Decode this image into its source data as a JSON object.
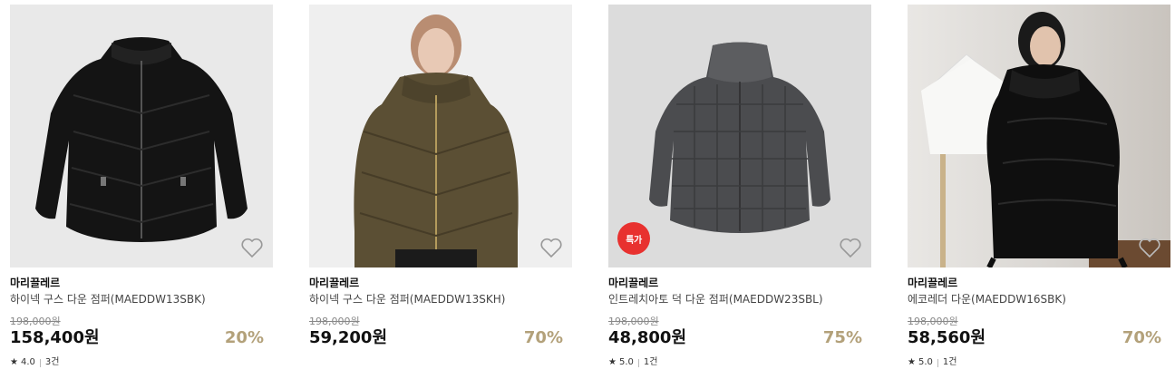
{
  "products": [
    {
      "brand": "마리끌레르",
      "name": "하이넥 구스 다운 점퍼(MAEDDW13SBK)",
      "original_price": "198,000원",
      "price": "158,400원",
      "discount": "20%",
      "rating": "4.0",
      "reviews": "3건",
      "image": "black-puffer-jacket"
    },
    {
      "brand": "마리끌레르",
      "name": "하이넥 구스 다운 점퍼(MAEDDW13SKH)",
      "original_price": "198,000원",
      "price": "59,200원",
      "discount": "70%",
      "image": "khaki-puffer-jacket-model"
    },
    {
      "brand": "마리끌레르",
      "name": "인트레치아토 덕 다운 점퍼(MAEDDW23SBL)",
      "original_price": "198,000원",
      "price": "48,800원",
      "discount": "75%",
      "rating": "5.0",
      "reviews": "1건",
      "badge": "특가",
      "image": "grey-quilted-puffer-jacket"
    },
    {
      "brand": "마리끌레르",
      "name": "에코레더 다운(MAEDDW16SBK)",
      "original_price": "198,000원",
      "price": "58,560원",
      "discount": "70%",
      "rating": "5.0",
      "reviews": "1건",
      "image": "black-leather-down-jacket-model"
    }
  ],
  "colors": {
    "discount": "#b3a17a",
    "badge": "#e8312f"
  },
  "icons": {
    "wishlist": "heart-outline-icon",
    "rating": "star-icon"
  }
}
